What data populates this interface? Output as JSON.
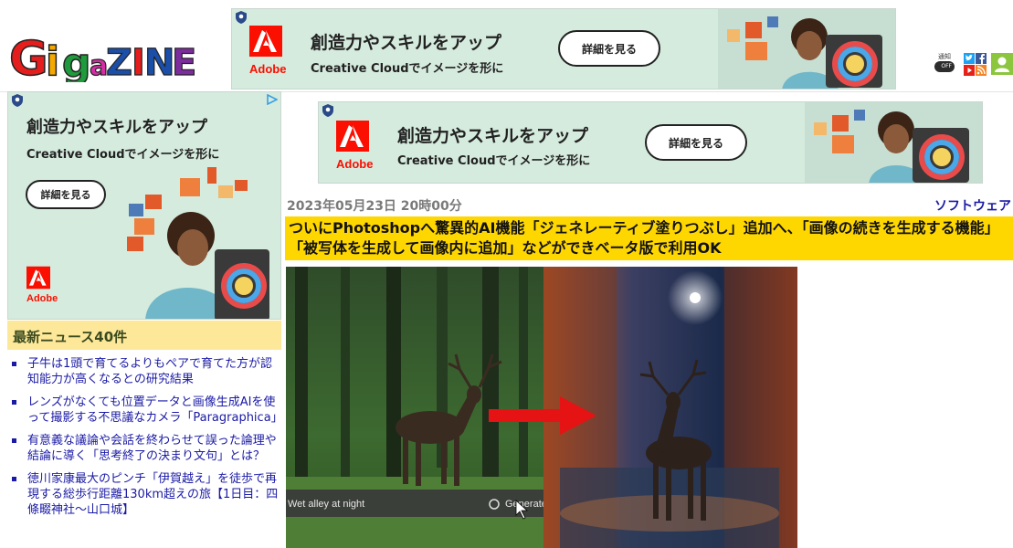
{
  "site": {
    "logo_text": "GIGAZINE",
    "logo_letters": [
      "G",
      "i",
      "g",
      "a",
      "Z",
      "I",
      "N",
      "E"
    ],
    "logo_colors": [
      "#e51d1d",
      "#f5a800",
      "#1f9a3c",
      "#d42ea6",
      "#1b4ea8",
      "#e51d1d",
      "#1b4ea8",
      "#7d2c9e"
    ]
  },
  "header_icons": {
    "notify_label": "通知",
    "notify_state": "OFF",
    "icons": [
      "twitter-icon",
      "facebook-icon",
      "youtube-icon",
      "rss-icon",
      "user-icon"
    ]
  },
  "ads": {
    "top": {
      "headline": "創造力やスキルをアップ",
      "sub": "Creative Cloudでイメージを形に",
      "cta": "詳細を見る",
      "brand": "Adobe"
    },
    "main": {
      "headline": "創造力やスキルをアップ",
      "sub": "Creative Cloudでイメージを形に",
      "cta": "詳細を見る",
      "brand": "Adobe"
    },
    "side": {
      "headline": "創造力やスキルをアップ",
      "sub": "Creative Cloudでイメージを形に",
      "cta": "詳細を見る",
      "brand": "Adobe"
    }
  },
  "sidebar": {
    "news_heading": "最新ニュース40件",
    "news": [
      {
        "title": "子牛は1頭で育てるよりもペアで育てた方が認知能力が高くなるとの研究結果"
      },
      {
        "title": "レンズがなくても位置データと画像生成AIを使って撮影する不思議なカメラ「Paragraphica」"
      },
      {
        "title": "有意義な議論や会話を終わらせて誤った論理や結論に導く「思考終了の決まり文句」とは？"
      },
      {
        "title": "徳川家康最大のピンチ「伊賀越え」を徒歩で再現する総歩行距離130km超えの旅【1日目：四條畷神社〜山口城】"
      }
    ]
  },
  "article": {
    "date": "2023年05月23日 20時00分",
    "category": "ソフトウェア",
    "title": "ついにPhotoshopへ驚異的AI機能「ジェネレーティブ塗りつぶし」追加へ、「画像の続きを生成する機能」「被写体を生成して画像内に追加」などができベータ版で利用OK",
    "image": {
      "prompt_text": "Wet alley at night",
      "generate_label": "Generate"
    }
  }
}
